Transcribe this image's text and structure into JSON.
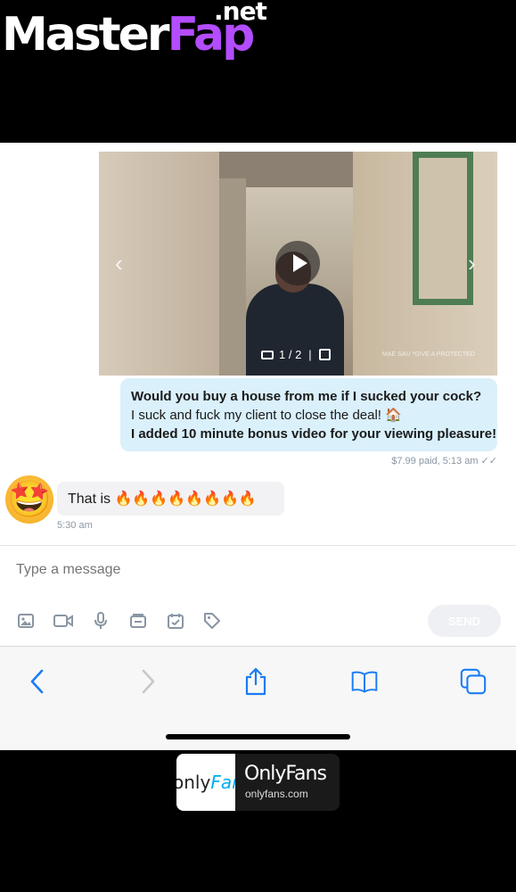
{
  "watermark": {
    "master": "Master",
    "fap": "Fap",
    "net": ".net"
  },
  "media": {
    "counter": "1 / 2",
    "overlay_text": "MAE SAU *GIVE A PROTECTED"
  },
  "outgoing": {
    "line1": "Would you buy a house from me if I sucked your cock?",
    "line2": "I suck and fuck my client to close the deal! 🏠",
    "line3": "I added 10 minute bonus video for your viewing pleasure!",
    "meta": "$7.99 paid,  5:13 am ✓✓"
  },
  "incoming": {
    "avatar": "🤩",
    "text": "That is 🔥🔥🔥🔥🔥🔥🔥🔥",
    "time": "5:30 am"
  },
  "composer": {
    "placeholder": "Type a message",
    "send_label": "SEND",
    "tools": [
      "image-icon",
      "video-icon",
      "microphone-icon",
      "vault-icon",
      "calendar-icon",
      "price-tag-icon"
    ]
  },
  "browser": {
    "icons": [
      "back-icon",
      "forward-icon",
      "share-icon",
      "bookmarks-icon",
      "tabs-icon"
    ]
  },
  "footer": {
    "logo_only": "only",
    "logo_fans": "Fans",
    "brand": "OnlyFans",
    "url": "onlyfans.com"
  },
  "colors": {
    "accent": "#00aff0",
    "bubble_out": "#daf0fb",
    "watermark_fap": "#b34dff"
  }
}
